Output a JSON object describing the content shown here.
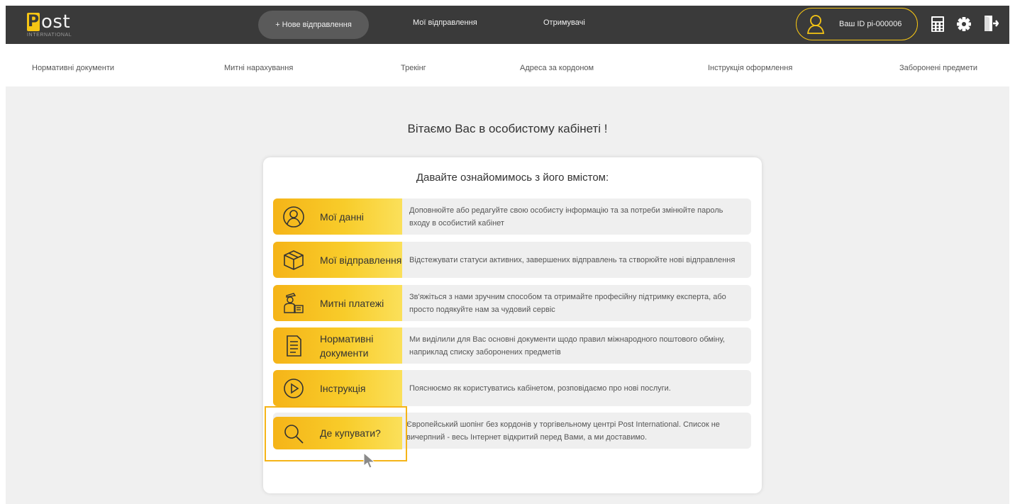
{
  "header": {
    "logo": {
      "letter": "P",
      "word": "ost",
      "sub": "INTERNATIONAL"
    },
    "new_shipment": "+ Нове відправлення",
    "my_shipments": "Мої відправлення",
    "recipients": "Отримувачі",
    "user_id": "Ваш ID pi-000006",
    "icons": [
      "user-icon",
      "calculator-icon",
      "gear-icon",
      "logout-icon"
    ]
  },
  "subnav": [
    "Нормативні документи",
    "Митні нарахування",
    "Трекінг",
    "Адреса за кордоном",
    "Інструкція оформлення",
    "Заборонені предмети"
  ],
  "welcome": "Вітаємо Вас в особистому кабінеті !",
  "card": {
    "title": "Давайте ознайомимось з його вмістом:",
    "rows": [
      {
        "label": "Мої данні",
        "icon": "user-icon",
        "desc": "Доповнюйте або редагуйте свою особисту інформацію та за потреби змінюйте пароль входу в особистий кабінет"
      },
      {
        "label": "Мої відправлення",
        "icon": "box-icon",
        "desc": "Відстежувати статуси активних, завершених відправлень та створюйте нові відправлення"
      },
      {
        "label": "Митні платежі",
        "icon": "customs-officer-icon",
        "desc": "Зв'яжіться з нами зручним способом та отримайте професійну підтримку експерта, або просто подякуйте нам за чудовий сервіс"
      },
      {
        "label": "Нормативні документи",
        "icon": "document-icon",
        "desc": "Ми виділили для Вас основні документи щодо правил міжнародного поштового обміну, наприклад списку заборонених предметів"
      },
      {
        "label": "Інструкція",
        "icon": "play-icon",
        "desc": "Пояснюємо як користуватись кабінетом, розповідаємо про нові послуги."
      },
      {
        "label": "Де купувати?",
        "icon": "search-icon",
        "desc": "Європейський шопінг без кордонів у торгівельному центрі Post International. Список не вичерпний - весь Інтернет відкритий перед Вами, а ми доставимо."
      }
    ]
  },
  "colors": {
    "accent": "#f6c514",
    "header_bg": "#3a3a3a",
    "main_bg": "#f0f0f0"
  }
}
